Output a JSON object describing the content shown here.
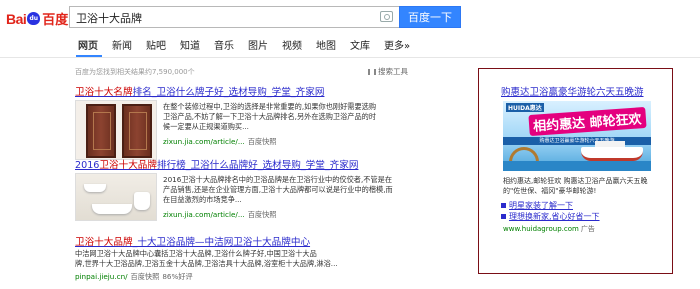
{
  "logo": {
    "text_latin": "Bai",
    "text_paw": "du",
    "text_cn": "百度"
  },
  "search": {
    "query": "卫浴十大品牌",
    "button": "百度一下"
  },
  "tabs": [
    {
      "label": "网页"
    },
    {
      "label": "新闻"
    },
    {
      "label": "贴吧"
    },
    {
      "label": "知道"
    },
    {
      "label": "音乐"
    },
    {
      "label": "图片"
    },
    {
      "label": "视频"
    },
    {
      "label": "地图"
    },
    {
      "label": "文库"
    },
    {
      "label": "更多»"
    }
  ],
  "results_count": "百度为您找到相关结果约7,590,000个",
  "tools_label": "搜索工具",
  "results": [
    {
      "title_em": "卫浴十大名牌",
      "title_rest": "排名_卫浴什么牌子好_选材导购_学堂_齐家网",
      "desc_lines": [
        "在整个装修过程中,卫浴的选择是非常重要的,如果你也刚好需要选购",
        "卫浴产品,不妨了解一下卫浴十大品牌排名,另外在选购卫浴产品的时",
        "候一定要从正规渠道购买..."
      ],
      "url": "zixun.jia.com/article/...",
      "snapshot": "百度快照"
    },
    {
      "title_a": "2016",
      "title_em": "卫浴十大品牌",
      "title_rest": "排行榜_卫浴什么品牌好_选材导购_学堂_齐家网",
      "desc_lines": [
        "2016卫浴十大品牌排名中的卫浴品牌是在卫浴行业中的佼佼者,不管是在",
        "产品销售,还是在企业管理方面,卫浴十大品牌都可以说是行业中的楷模,而",
        "在目益激烈的市场竞争..."
      ],
      "url": "zixun.jia.com/article/...",
      "snapshot": "百度快照"
    },
    {
      "title_em": "卫浴十大品牌",
      "title_rest": "_十大卫浴品牌—中洁网卫浴十大品牌中心",
      "desc_lines": [
        "中洁网卫浴十大品牌中心囊括卫浴十大品牌,卫浴什么牌子好,中国卫浴十大品",
        "牌,世界十大卫浴品牌,卫浴五金十大品牌,卫浴洁具十大品牌,浴室柜十大品牌,淋浴..."
      ],
      "url": "pinpai.jieju.cn/",
      "snapshot": "百度快照",
      "rating": "86%好评"
    }
  ],
  "ad": {
    "title": "购惠达卫浴赢豪华游轮六天五晚游",
    "banner_brand": "HUIDA惠达",
    "banner_slogan": "相约惠达 邮轮狂欢",
    "banner_strip": "购惠达卫浴赢豪华游轮六天五晚游",
    "desc": "相约惠达,邮轮狂欢 购惠达卫浴产品赢六天五晚的\"佐世保、福冈\"豪华邮轮游!",
    "links": [
      "明星家装了解一下",
      "理想换新家,省心好省一下"
    ],
    "url": "www.huidagroup.com",
    "url_tag": "广告"
  },
  "colors": {
    "link": "#2b2bcc",
    "highlight": "#cc0000",
    "url": "#008000",
    "accent": "#3385ff",
    "ad_border": "#7a0e16"
  }
}
